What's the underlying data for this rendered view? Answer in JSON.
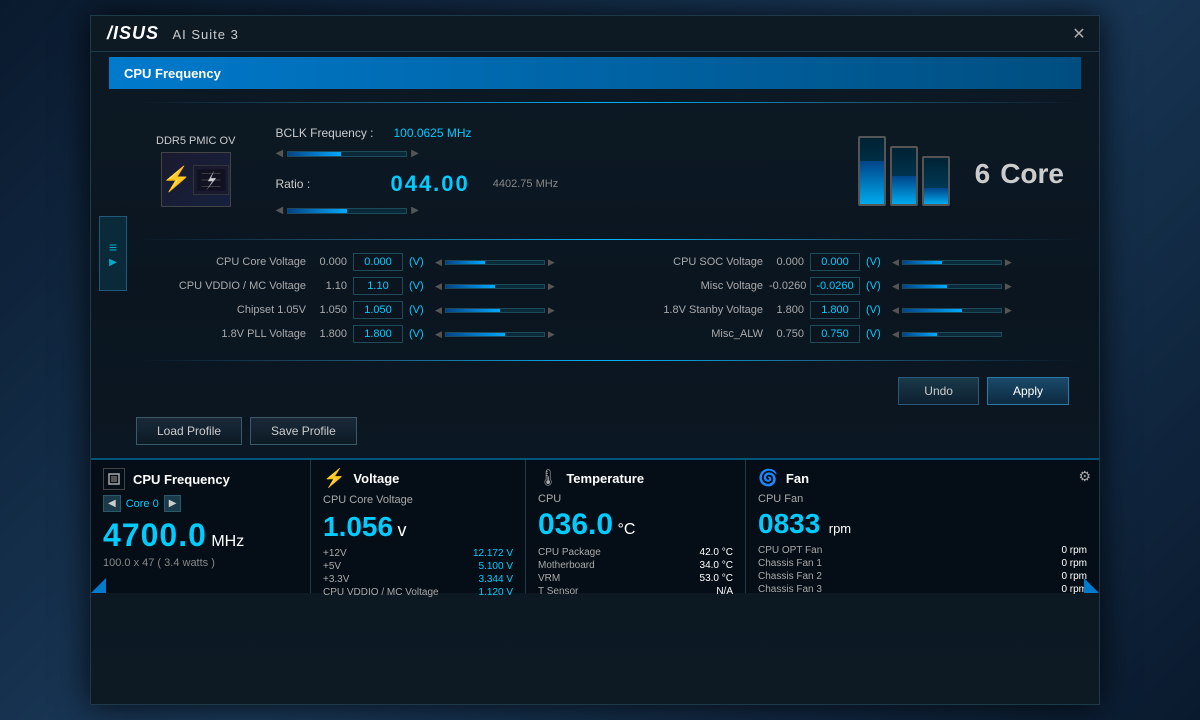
{
  "app": {
    "title": "ASUS",
    "subtitle": "AI Suite 3",
    "close_label": "✕"
  },
  "header": {
    "title": "CPU Frequency"
  },
  "ddr5": {
    "label": "DDR5 PMIC OV"
  },
  "bclk": {
    "label": "BCLK Frequency :",
    "value": "100.0625 MHz",
    "ratio_label": "Ratio :",
    "ratio_value": "044.00",
    "ratio_mhz": "4402.75 MHz"
  },
  "core": {
    "count": "6",
    "label": "Core"
  },
  "voltages_left": [
    {
      "label": "CPU Core Voltage",
      "base": "0.000",
      "value": "0.000",
      "unit": "(V)",
      "fill": 40
    },
    {
      "label": "CPU VDDIO / MC Voltage",
      "base": "1.10",
      "value": "1.10",
      "unit": "(V)",
      "fill": 50
    },
    {
      "label": "Chipset 1.05V",
      "base": "1.050",
      "value": "1.050",
      "unit": "(V)",
      "fill": 55
    },
    {
      "label": "1.8V PLL Voltage",
      "base": "1.800",
      "value": "1.800",
      "unit": "(V)",
      "fill": 60
    }
  ],
  "voltages_right": [
    {
      "label": "CPU SOC Voltage",
      "base": "0.000",
      "value": "0.000",
      "unit": "(V)",
      "fill": 40
    },
    {
      "label": "Misc Voltage",
      "base": "-0.0260",
      "value": "-0.0260",
      "unit": "(V)",
      "fill": 45
    },
    {
      "label": "1.8V Stanby Voltage",
      "base": "1.800",
      "value": "1.800",
      "unit": "(V)",
      "fill": 60
    },
    {
      "label": "Misc_ALW",
      "base": "0.750",
      "value": "0.750",
      "unit": "(V)",
      "fill": 35
    }
  ],
  "buttons": {
    "undo": "Undo",
    "apply": "Apply",
    "load_profile": "Load Profile",
    "save_profile": "Save Profile"
  },
  "status": {
    "cpu_freq": {
      "title": "CPU Frequency",
      "core_label": "Core 0",
      "value": "4700.0",
      "unit": "MHz",
      "sub": "100.0  x  47   ( 3.4  watts )"
    },
    "voltage": {
      "title": "Voltage",
      "cpu_label": "CPU Core Voltage",
      "cpu_value": "1.056",
      "unit": "v",
      "items": [
        {
          "label": "+12V",
          "value": "12.172 V"
        },
        {
          "label": "+5V",
          "value": "5.100 V"
        },
        {
          "label": "+3.3V",
          "value": "3.344 V"
        },
        {
          "label": "CPU VDDIO / MC Voltage",
          "value": "1.120 V"
        }
      ]
    },
    "temperature": {
      "title": "Temperature",
      "cpu_label": "CPU",
      "cpu_value": "036.0",
      "unit": "°C",
      "items": [
        {
          "label": "CPU Package",
          "value": "42.0 °C"
        },
        {
          "label": "Motherboard",
          "value": "34.0 °C"
        },
        {
          "label": "VRM",
          "value": "53.0 °C"
        },
        {
          "label": "T Sensor",
          "value": "N/A"
        }
      ]
    },
    "fan": {
      "title": "Fan",
      "cpu_label": "CPU Fan",
      "cpu_value": "0833",
      "unit": "rpm",
      "items": [
        {
          "label": "CPU OPT Fan",
          "value": "0 rpm"
        },
        {
          "label": "Chassis Fan 1",
          "value": "0 rpm"
        },
        {
          "label": "Chassis Fan 2",
          "value": "0 rpm"
        },
        {
          "label": "Chassis Fan 3",
          "value": "0 rpm"
        }
      ]
    }
  }
}
